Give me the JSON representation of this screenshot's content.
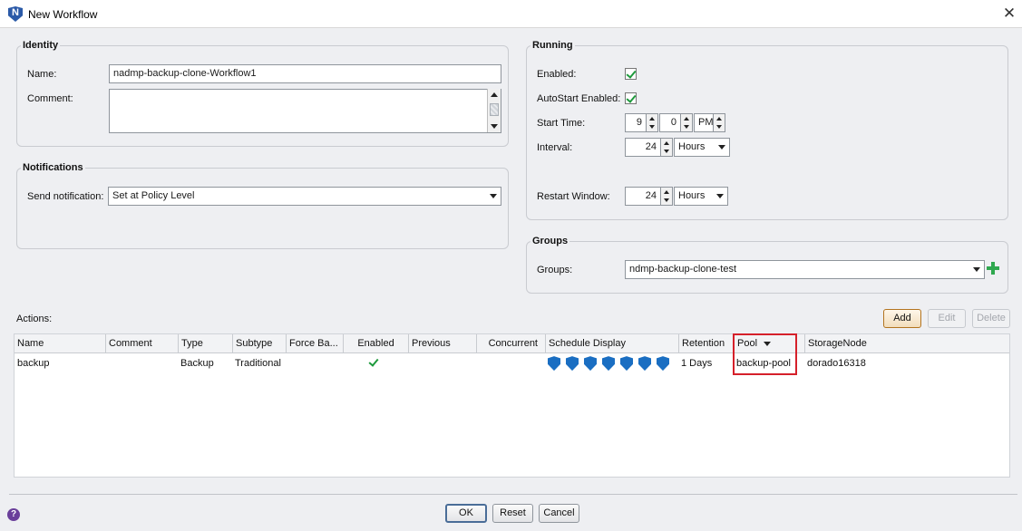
{
  "window": {
    "title": "New Workflow"
  },
  "identity": {
    "legend": "Identity",
    "name_label": "Name:",
    "name_value": "nadmp-backup-clone-Workflow1",
    "comment_label": "Comment:",
    "comment_value": ""
  },
  "notifications": {
    "legend": "Notifications",
    "send_label": "Send notification:",
    "send_value": "Set at Policy Level"
  },
  "running": {
    "legend": "Running",
    "enabled_label": "Enabled:",
    "enabled_checked": true,
    "autostart_label": "AutoStart Enabled:",
    "autostart_checked": true,
    "start_time_label": "Start Time:",
    "start_hour": "9",
    "start_minute": "0",
    "start_ampm": "PM",
    "interval_label": "Interval:",
    "interval_value": "24",
    "interval_unit": "Hours",
    "restart_label": "Restart Window:",
    "restart_value": "24",
    "restart_unit": "Hours"
  },
  "groups": {
    "legend": "Groups",
    "groups_label": "Groups:",
    "groups_value": "ndmp-backup-clone-test"
  },
  "actions": {
    "label": "Actions:",
    "add_label": "Add",
    "edit_label": "Edit",
    "delete_label": "Delete",
    "columns": [
      "Name",
      "Comment",
      "Type",
      "Subtype",
      "Force Ba...",
      "Enabled",
      "Previous",
      "Concurrent",
      "Schedule Display",
      "Retention",
      "Pool",
      "StorageNode"
    ],
    "rows": [
      {
        "name": "backup",
        "comment": "",
        "type": "Backup",
        "subtype": "Traditional",
        "force": "",
        "enabled": true,
        "previous": "",
        "concurrent": "",
        "schedule_icons": 7,
        "retention": "1 Days",
        "pool": "backup-pool",
        "storage_node": "dorado16318"
      }
    ]
  },
  "footer": {
    "ok_label": "OK",
    "reset_label": "Reset",
    "cancel_label": "Cancel"
  },
  "icons": {
    "app": "networker-logo-icon",
    "close": "close-icon",
    "help": "help-icon",
    "add_group": "plus-icon",
    "schedule": "shield-icon",
    "check": "checkmark-icon"
  },
  "colors": {
    "accent_border": "#d5202a",
    "check_green": "#1d9a3c",
    "shield_blue": "#1a6ec2",
    "help_purple": "#6a3f9a"
  }
}
